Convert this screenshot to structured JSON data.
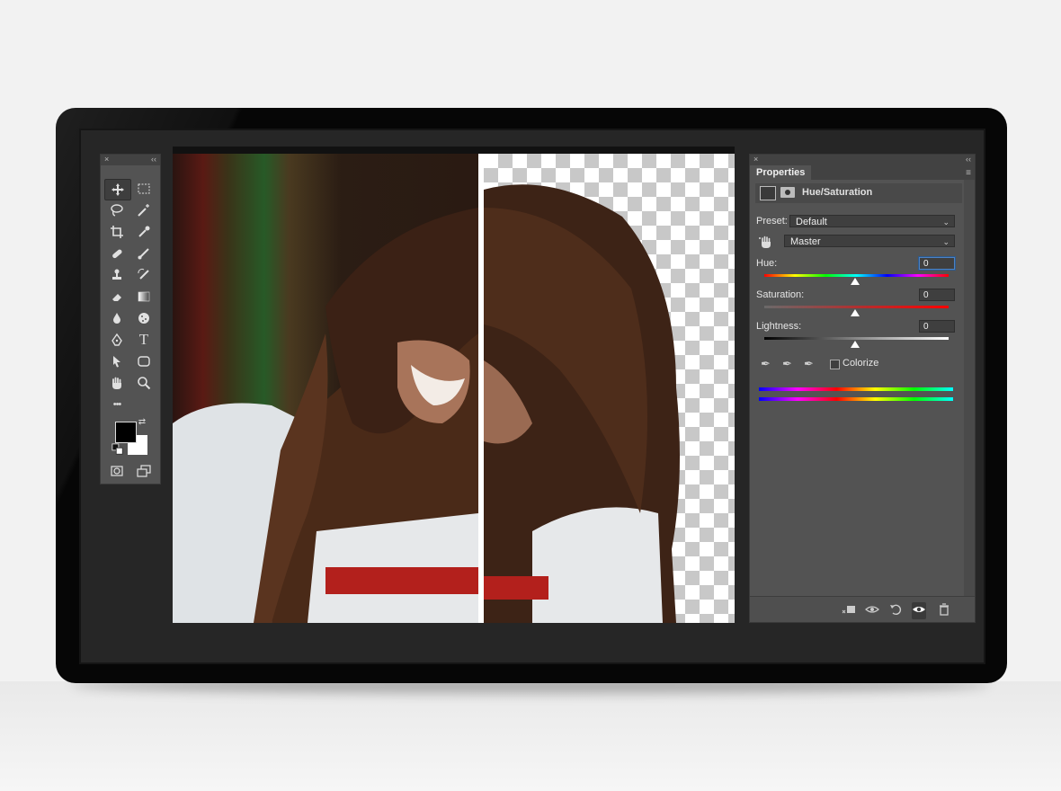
{
  "tools_panel": {
    "close_icon": "×",
    "collapse_icon": "‹‹"
  },
  "properties": {
    "close_icon": "×",
    "collapse_icon": "‹‹",
    "tab_label": "Properties",
    "menu_icon": "≡",
    "adjustment_title": "Hue/Saturation",
    "preset_label": "Preset:",
    "preset_value": "Default",
    "channel_value": "Master",
    "hue_label": "Hue:",
    "hue_value": "0",
    "saturation_label": "Saturation:",
    "saturation_value": "0",
    "lightness_label": "Lightness:",
    "lightness_value": "0",
    "colorize_label": "Colorize",
    "colorize_checked": false,
    "slider_levels": {
      "hue": 0.5,
      "saturation": 0.5,
      "lightness": 0.5
    }
  },
  "icons": {
    "move": "move-tool-icon",
    "marquee": "rect-marquee-icon",
    "lasso": "lasso-icon",
    "magic_wand": "magic-wand-icon",
    "crop": "crop-icon",
    "eyedropper": "eyedropper-icon",
    "healing": "healing-brush-icon",
    "brush": "brush-icon",
    "stamp": "clone-stamp-icon",
    "history_brush": "history-brush-icon",
    "eraser": "eraser-icon",
    "gradient": "gradient-icon",
    "blur": "blur-drop-icon",
    "sponge": "sponge-icon",
    "pen": "pen-icon",
    "type": "type-icon",
    "path_select": "path-select-icon",
    "shape": "rounded-rect-icon",
    "hand": "hand-icon",
    "zoom": "zoom-icon",
    "more": "more-icon"
  },
  "glyphs": {
    "type": "T",
    "more": "•••",
    "swap": "⇄",
    "eyedrop": "✒",
    "trash": "🗑",
    "eye": "◉"
  },
  "colors": {
    "panel": "#535353",
    "panel_header": "#424242",
    "accent_focus": "#4d82c4"
  }
}
